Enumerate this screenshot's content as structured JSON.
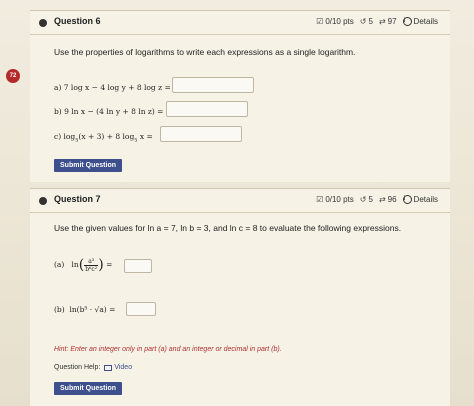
{
  "badge": "72",
  "q6": {
    "title": "Question 6",
    "pts": "0/10 pts",
    "retries": "5",
    "attempts": "97",
    "details": "Details",
    "prompt": "Use the properties of logarithms to write each expressions as a single logarithm.",
    "parts": [
      {
        "label": "a) 7 log x − 4 log y + 8 log z ="
      },
      {
        "label": "b) 9 ln x − (4 ln y + 8 ln z) ="
      },
      {
        "label": "c) log",
        "base": "5",
        "rest": "(x + 3) + 8 log",
        "base2": "5",
        "end": " x ="
      }
    ],
    "submit": "Submit Question"
  },
  "q7": {
    "title": "Question 7",
    "pts": "0/10 pts",
    "retries": "5",
    "attempts": "96",
    "details": "Details",
    "prompt": "Use the given values for ln a = 7, ln b = 3, and ln c = 8 to evaluate the following expressions.",
    "part_a_label": "(a)",
    "part_a_fn": "ln",
    "part_a_num": "a³",
    "part_a_den": "b⁶c²",
    "part_a_eq": "=",
    "part_b_label": "(b)",
    "part_b_expr": "ln(b⁵ · √a) =",
    "hint": "Hint: Enter an integer only in part (a) and an integer or decimal in part (b).",
    "help_label": "Question Help:",
    "video": "Video",
    "submit": "Submit Question"
  },
  "icons": {
    "pts": "pencil-square-icon",
    "retry": "retry-icon",
    "attempts": "repeat-icon",
    "details": "info-icon",
    "video": "video-icon"
  }
}
